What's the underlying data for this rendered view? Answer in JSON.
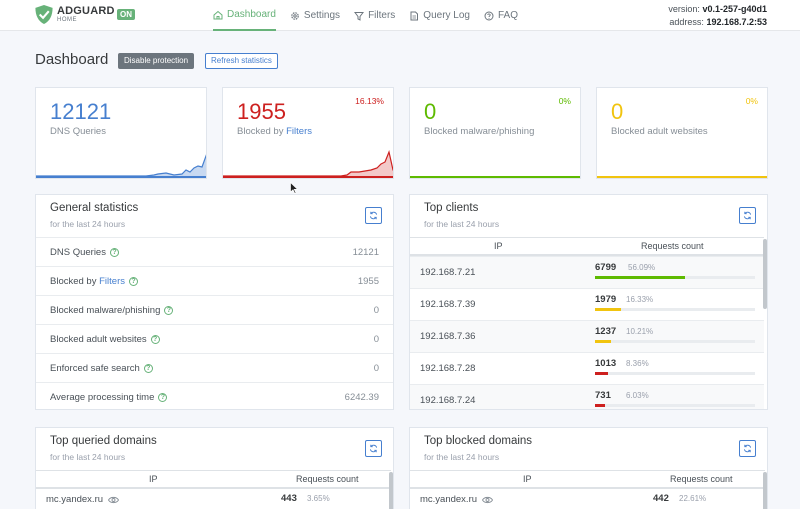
{
  "header": {
    "logo_name": "ADGUARD",
    "logo_sub": "HOME",
    "status_badge": "ON",
    "nav": [
      {
        "label": "Dashboard",
        "icon": "home-icon"
      },
      {
        "label": "Settings",
        "icon": "gear-icon"
      },
      {
        "label": "Filters",
        "icon": "filter-icon"
      },
      {
        "label": "Query Log",
        "icon": "document-icon"
      },
      {
        "label": "FAQ",
        "icon": "help-circle-icon"
      }
    ],
    "version_label": "version:",
    "version_value": "v0.1-257-g40d1",
    "address_label": "address:",
    "address_value": "192.168.7.2:53"
  },
  "page": {
    "title": "Dashboard",
    "disable_button": "Disable protection",
    "refresh_button": "Refresh statistics"
  },
  "stat_cards": [
    {
      "value": "12121",
      "label": "DNS Queries",
      "label_link": "",
      "pct": "",
      "color": "#467fcf"
    },
    {
      "value": "1955",
      "label": "Blocked by ",
      "label_link": "Filters",
      "pct": "16.13%",
      "color": "#cd201f"
    },
    {
      "value": "0",
      "label": "Blocked malware/phishing",
      "label_link": "",
      "pct": "0%",
      "color": "#5eba00"
    },
    {
      "value": "0",
      "label": "Blocked adult websites",
      "label_link": "",
      "pct": "0%",
      "color": "#f1c40f"
    }
  ],
  "general": {
    "title": "General statistics",
    "subtitle": "for the last 24 hours",
    "rows": [
      {
        "label": "DNS Queries",
        "link": "",
        "value": "12121"
      },
      {
        "label": "Blocked by ",
        "link": "Filters",
        "value": "1955"
      },
      {
        "label": "Blocked malware/phishing",
        "link": "",
        "value": "0"
      },
      {
        "label": "Blocked adult websites",
        "link": "",
        "value": "0"
      },
      {
        "label": "Enforced safe search",
        "link": "",
        "value": "0"
      },
      {
        "label": "Average processing time",
        "link": "",
        "value": "6242.39"
      }
    ]
  },
  "clients": {
    "title": "Top clients",
    "subtitle": "for the last 24 hours",
    "col_ip": "IP",
    "col_count": "Requests count",
    "rows": [
      {
        "ip": "192.168.7.21",
        "count": "6799",
        "pct": "56.09%",
        "fraction": 0.5609,
        "color": "#5eba00"
      },
      {
        "ip": "192.168.7.39",
        "count": "1979",
        "pct": "16.33%",
        "fraction": 0.1633,
        "color": "#f1c40f"
      },
      {
        "ip": "192.168.7.36",
        "count": "1237",
        "pct": "10.21%",
        "fraction": 0.1021,
        "color": "#f1c40f"
      },
      {
        "ip": "192.168.7.28",
        "count": "1013",
        "pct": "8.36%",
        "fraction": 0.0836,
        "color": "#cd201f"
      },
      {
        "ip": "192.168.7.24",
        "count": "731",
        "pct": "6.03%",
        "fraction": 0.0603,
        "color": "#cd201f"
      }
    ]
  },
  "queried": {
    "title": "Top queried domains",
    "subtitle": "for the last 24 hours",
    "col_ip": "IP",
    "col_count": "Requests count",
    "first_domain": "mc.yandex.ru",
    "first_count": "443",
    "first_pct": "3.65%"
  },
  "blocked": {
    "title": "Top blocked domains",
    "subtitle": "for the last 24 hours",
    "col_ip": "IP",
    "col_count": "Requests count",
    "first_domain": "mc.yandex.ru",
    "first_count": "442",
    "first_pct": "22.61%"
  },
  "colors": {
    "accent": "#67b279",
    "link": "#467fcf",
    "danger": "#cd201f",
    "success": "#5eba00",
    "warning": "#f1c40f"
  }
}
